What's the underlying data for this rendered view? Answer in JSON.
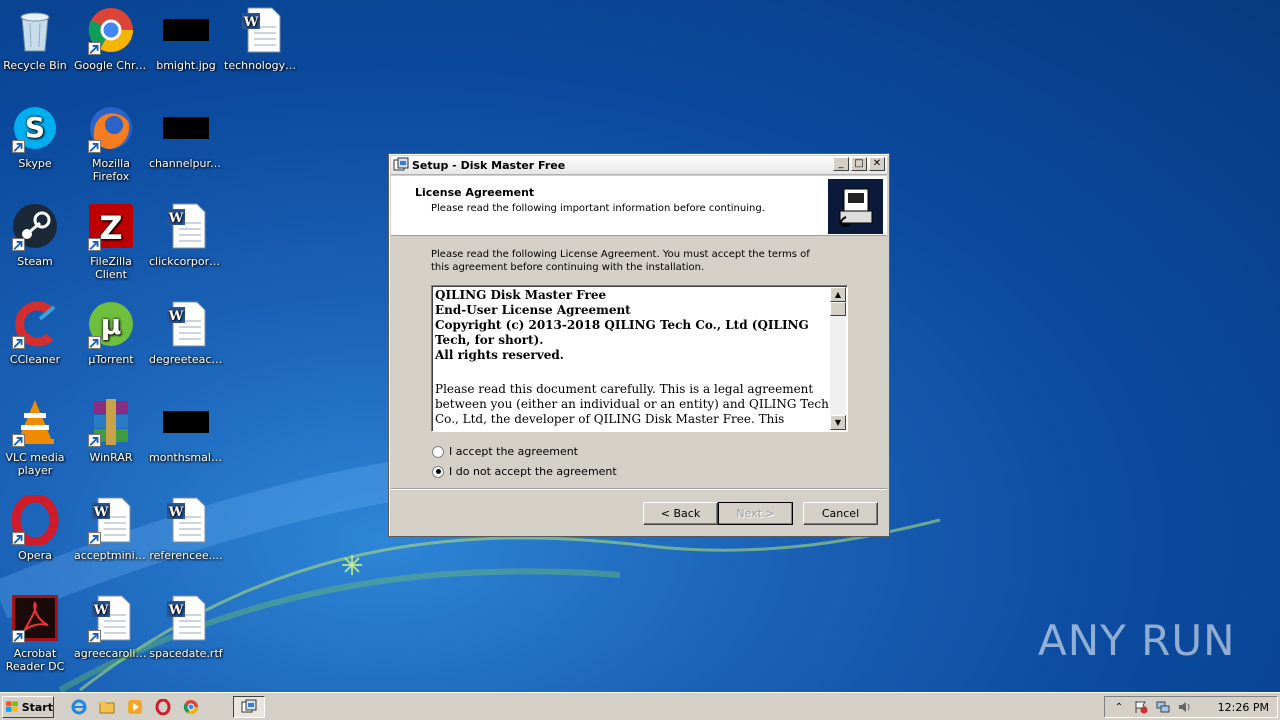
{
  "desktop": {
    "icons": [
      {
        "label": "Recycle Bin",
        "icon": "recycle-bin-icon"
      },
      {
        "label": "Google Chrome",
        "icon": "chrome-icon"
      },
      {
        "label": "bmight.jpg",
        "icon": "image-file-icon"
      },
      {
        "label": "technologyc....",
        "icon": "word-document-icon"
      },
      {
        "label": "Skype",
        "icon": "skype-icon"
      },
      {
        "label": "Mozilla Firefox",
        "icon": "firefox-icon"
      },
      {
        "label": "channelpur....",
        "icon": "image-file-icon"
      },
      {
        "label": "Steam",
        "icon": "steam-icon"
      },
      {
        "label": "FileZilla Client",
        "icon": "filezilla-icon"
      },
      {
        "label": "clickcorpora....",
        "icon": "word-document-icon"
      },
      {
        "label": "CCleaner",
        "icon": "ccleaner-icon"
      },
      {
        "label": "µTorrent",
        "icon": "utorrent-icon"
      },
      {
        "label": "degreeteac....",
        "icon": "word-document-icon"
      },
      {
        "label": "VLC media player",
        "icon": "vlc-icon"
      },
      {
        "label": "WinRAR",
        "icon": "winrar-icon"
      },
      {
        "label": "monthsmalli....",
        "icon": "image-file-icon"
      },
      {
        "label": "Opera",
        "icon": "opera-icon"
      },
      {
        "label": "acceptmini....",
        "icon": "word-document-icon"
      },
      {
        "label": "referencee....",
        "icon": "word-document-icon"
      },
      {
        "label": "Acrobat Reader DC",
        "icon": "acrobat-icon"
      },
      {
        "label": "agreecaroli....",
        "icon": "word-document-icon"
      },
      {
        "label": "spacedate.rtf",
        "icon": "word-document-icon"
      }
    ]
  },
  "dialog": {
    "title": "Setup - Disk Master Free",
    "header_title": "License Agreement",
    "header_subtitle": "Please read the following important information before continuing.",
    "instructions": "Please read the following License Agreement. You must accept the terms of this agreement before continuing with the installation.",
    "license_lines": {
      "l1": "QILING Disk Master Free",
      "l2": "End-User License Agreement",
      "l3": "Copyright (c) 2013-2018 QILING Tech Co., Ltd (QILING Tech, for short).",
      "l4": "All rights reserved.",
      "p1": "Please read this document carefully. This is a legal agreement between you (either an individual or an entity) and QILING Tech Co., Ltd, the developer of QILING Disk Master Free. This agreement"
    },
    "radio_accept": "I accept the agreement",
    "radio_decline": "I do not accept the agreement",
    "selected": "decline",
    "btn_back": "< Back",
    "btn_next": "Next >",
    "btn_cancel": "Cancel"
  },
  "taskbar": {
    "start_label": "Start",
    "clock": "12:26 PM"
  },
  "watermark": "ANY RUN"
}
